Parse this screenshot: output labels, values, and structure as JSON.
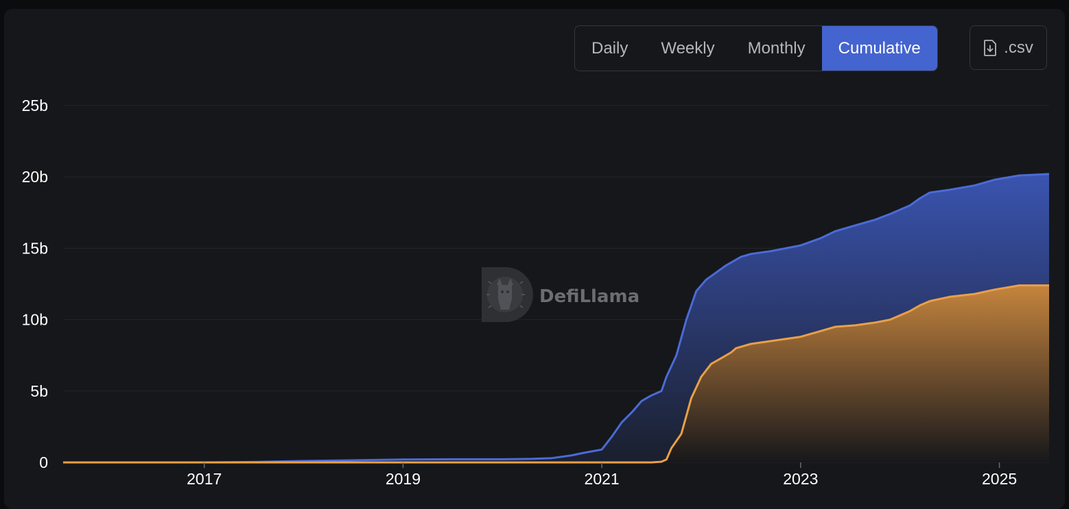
{
  "toolbar": {
    "tabs": [
      {
        "label": "Daily"
      },
      {
        "label": "Weekly"
      },
      {
        "label": "Monthly"
      },
      {
        "label": "Cumulative"
      }
    ],
    "active_tab": "Cumulative",
    "csv_label": ".csv",
    "csv_icon": "file-download-icon",
    "accent_color": "#4464cf"
  },
  "watermark": {
    "text": "DefiLlama",
    "icon": "llama-logo-icon"
  },
  "chart_data": {
    "type": "area",
    "title": "",
    "xlabel": "",
    "ylabel": "",
    "x_ticks": [
      "2017",
      "2019",
      "2021",
      "2023",
      "2025"
    ],
    "y_ticks": [
      "0",
      "5b",
      "10b",
      "15b",
      "20b",
      "25b"
    ],
    "ylim": [
      0,
      25
    ],
    "xlim": [
      2015.58,
      2025.5
    ],
    "grid": true,
    "legend": "none",
    "series": [
      {
        "color": "#4b6bd6",
        "x": [
          2015.58,
          2016.5,
          2017.0,
          2017.5,
          2018.0,
          2018.5,
          2019.0,
          2019.5,
          2020.0,
          2020.3,
          2020.5,
          2020.7,
          2020.8,
          2021.0,
          2021.1,
          2021.2,
          2021.3,
          2021.4,
          2021.45,
          2021.5,
          2021.6,
          2021.65,
          2021.75,
          2021.85,
          2021.95,
          2022.05,
          2022.15,
          2022.25,
          2022.35,
          2022.4,
          2022.5,
          2022.7,
          2023.0,
          2023.2,
          2023.35,
          2023.5,
          2023.75,
          2023.9,
          2024.1,
          2024.2,
          2024.3,
          2024.5,
          2024.75,
          2024.95,
          2025.2,
          2025.5
        ],
        "values": [
          0.0,
          0.0,
          0.0,
          0.03,
          0.1,
          0.15,
          0.2,
          0.22,
          0.22,
          0.25,
          0.3,
          0.5,
          0.65,
          0.9,
          1.8,
          2.8,
          3.5,
          4.3,
          4.5,
          4.7,
          5.0,
          6.0,
          7.5,
          10.0,
          12.0,
          12.8,
          13.3,
          13.8,
          14.2,
          14.4,
          14.6,
          14.8,
          15.2,
          15.7,
          16.2,
          16.5,
          17.0,
          17.4,
          18.0,
          18.5,
          18.9,
          19.1,
          19.4,
          19.8,
          20.1,
          20.2
        ]
      },
      {
        "color": "#e9a048",
        "x": [
          2015.58,
          2016.5,
          2017.0,
          2018.0,
          2019.0,
          2020.0,
          2021.0,
          2021.5,
          2021.6,
          2021.65,
          2021.7,
          2021.8,
          2021.9,
          2022.0,
          2022.1,
          2022.2,
          2022.3,
          2022.35,
          2022.5,
          2022.7,
          2023.0,
          2023.2,
          2023.35,
          2023.55,
          2023.75,
          2023.9,
          2024.1,
          2024.2,
          2024.3,
          2024.5,
          2024.75,
          2024.95,
          2025.2,
          2025.5
        ],
        "values": [
          0.0,
          0.0,
          0.0,
          0.0,
          0.0,
          0.0,
          0.0,
          0.0,
          0.05,
          0.2,
          1.0,
          2.0,
          4.5,
          6.0,
          6.9,
          7.3,
          7.7,
          8.0,
          8.3,
          8.5,
          8.8,
          9.2,
          9.5,
          9.6,
          9.8,
          10.0,
          10.6,
          11.0,
          11.3,
          11.6,
          11.8,
          12.1,
          12.4,
          12.4
        ]
      }
    ]
  }
}
